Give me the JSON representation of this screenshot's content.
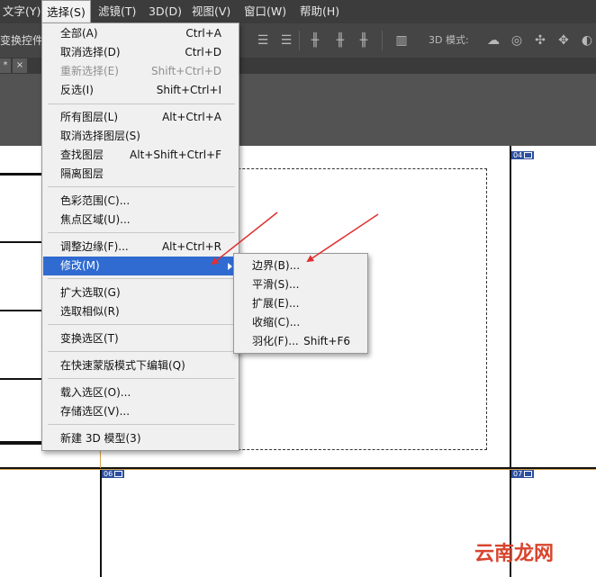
{
  "menubar": {
    "items": [
      {
        "label": "文字(Y)"
      },
      {
        "label": "选择(S)"
      },
      {
        "label": "滤镜(T)"
      },
      {
        "label": "3D(D)"
      },
      {
        "label": "视图(V)"
      },
      {
        "label": "窗口(W)"
      },
      {
        "label": "帮助(H)"
      }
    ]
  },
  "optbar": {
    "transform_label": "变换控件",
    "mode3d_label": "3D 模式:"
  },
  "tabbar": {
    "tab_star": "*",
    "tab_close": "×"
  },
  "select_menu": {
    "items": [
      {
        "label": "全部(A)",
        "shortcut": "Ctrl+A"
      },
      {
        "label": "取消选择(D)",
        "shortcut": "Ctrl+D"
      },
      {
        "label": "重新选择(E)",
        "shortcut": "Shift+Ctrl+D"
      },
      {
        "label": "反选(I)",
        "shortcut": "Shift+Ctrl+I"
      },
      {
        "label": "所有图层(L)",
        "shortcut": "Alt+Ctrl+A"
      },
      {
        "label": "取消选择图层(S)",
        "shortcut": ""
      },
      {
        "label": "查找图层",
        "shortcut": "Alt+Shift+Ctrl+F"
      },
      {
        "label": "隔离图层",
        "shortcut": ""
      },
      {
        "label": "色彩范围(C)...",
        "shortcut": ""
      },
      {
        "label": "焦点区域(U)...",
        "shortcut": ""
      },
      {
        "label": "调整边缘(F)...",
        "shortcut": "Alt+Ctrl+R"
      },
      {
        "label": "修改(M)",
        "shortcut": ""
      },
      {
        "label": "扩大选取(G)",
        "shortcut": ""
      },
      {
        "label": "选取相似(R)",
        "shortcut": ""
      },
      {
        "label": "变换选区(T)",
        "shortcut": ""
      },
      {
        "label": "在快速蒙版模式下编辑(Q)",
        "shortcut": ""
      },
      {
        "label": "载入选区(O)...",
        "shortcut": ""
      },
      {
        "label": "存储选区(V)...",
        "shortcut": ""
      },
      {
        "label": "新建 3D 模型(3)",
        "shortcut": ""
      }
    ]
  },
  "modify_submenu": {
    "items": [
      {
        "label": "边界(B)...",
        "shortcut": ""
      },
      {
        "label": "平滑(S)...",
        "shortcut": ""
      },
      {
        "label": "扩展(E)...",
        "shortcut": ""
      },
      {
        "label": "收缩(C)...",
        "shortcut": ""
      },
      {
        "label": "羽化(F)...",
        "shortcut": "Shift+F6"
      }
    ]
  },
  "slices": {
    "s04": "04",
    "s06": "06",
    "s07": "07"
  },
  "watermark": "云南龙网",
  "colors": {
    "highlight": "#2f6bd0",
    "annotation_arrow": "#e03030",
    "guide": "#d4a24a"
  }
}
